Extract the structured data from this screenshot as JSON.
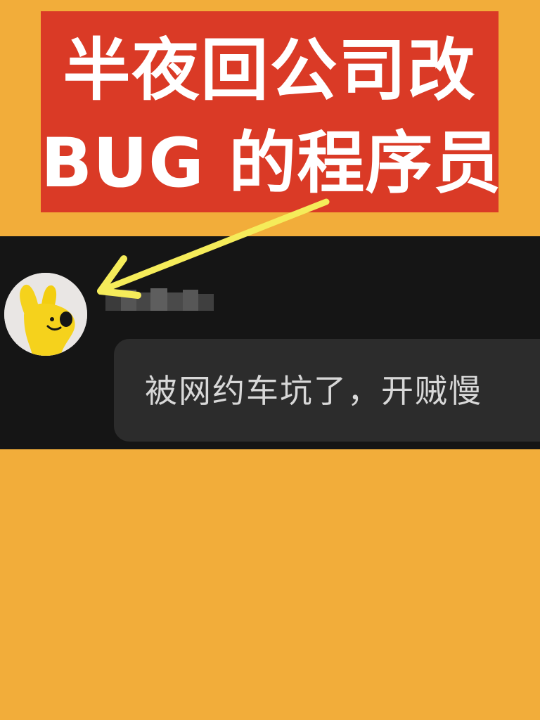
{
  "title": {
    "line1": "半夜回公司改",
    "line2": "BUG 的程序员"
  },
  "message": {
    "text": "被网约车坑了，开贼慢"
  },
  "colors": {
    "background": "#f2ad3a",
    "title_box": "#da3a26",
    "title_text": "#ffffff",
    "chat_band": "#151515",
    "bubble": "#2c2c2c",
    "bubble_text": "#d8d8d8",
    "arrow": "#f5ec5a",
    "avatar_character": "#f5d21c"
  },
  "icons": {
    "arrow": "arrow-pointing-left-icon",
    "avatar": "yellow-rabbit-avatar"
  }
}
